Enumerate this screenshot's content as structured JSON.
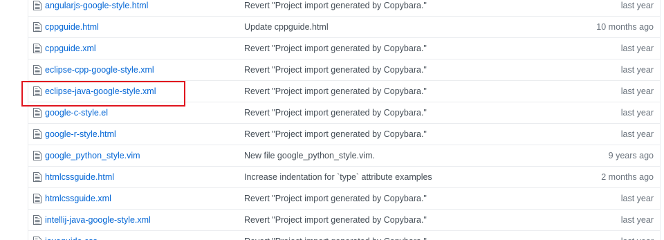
{
  "files": [
    {
      "name": "angularjs-google-style.html",
      "message": "Revert \"Project import generated by Copybara.\"",
      "age": "last year"
    },
    {
      "name": "cppguide.html",
      "message": "Update cppguide.html",
      "age": "10 months ago"
    },
    {
      "name": "cppguide.xml",
      "message": "Revert \"Project import generated by Copybara.\"",
      "age": "last year"
    },
    {
      "name": "eclipse-cpp-google-style.xml",
      "message": "Revert \"Project import generated by Copybara.\"",
      "age": "last year"
    },
    {
      "name": "eclipse-java-google-style.xml",
      "message": "Revert \"Project import generated by Copybara.\"",
      "age": "last year"
    },
    {
      "name": "google-c-style.el",
      "message": "Revert \"Project import generated by Copybara.\"",
      "age": "last year"
    },
    {
      "name": "google-r-style.html",
      "message": "Revert \"Project import generated by Copybara.\"",
      "age": "last year"
    },
    {
      "name": "google_python_style.vim",
      "message": "New file google_python_style.vim.",
      "age": "9 years ago"
    },
    {
      "name": "htmlcssguide.html",
      "message": "Increase indentation for `type` attribute examples",
      "age": "2 months ago"
    },
    {
      "name": "htmlcssguide.xml",
      "message": "Revert \"Project import generated by Copybara.\"",
      "age": "last year"
    },
    {
      "name": "intellij-java-google-style.xml",
      "message": "Revert \"Project import generated by Copybara.\"",
      "age": "last year"
    },
    {
      "name": "javaguide.css",
      "message": "Revert \"Project import generated by Copybara.\"",
      "age": "last year"
    }
  ],
  "icon": "file-icon",
  "highlight_color": "#e0141e",
  "link_color": "#0366d6"
}
